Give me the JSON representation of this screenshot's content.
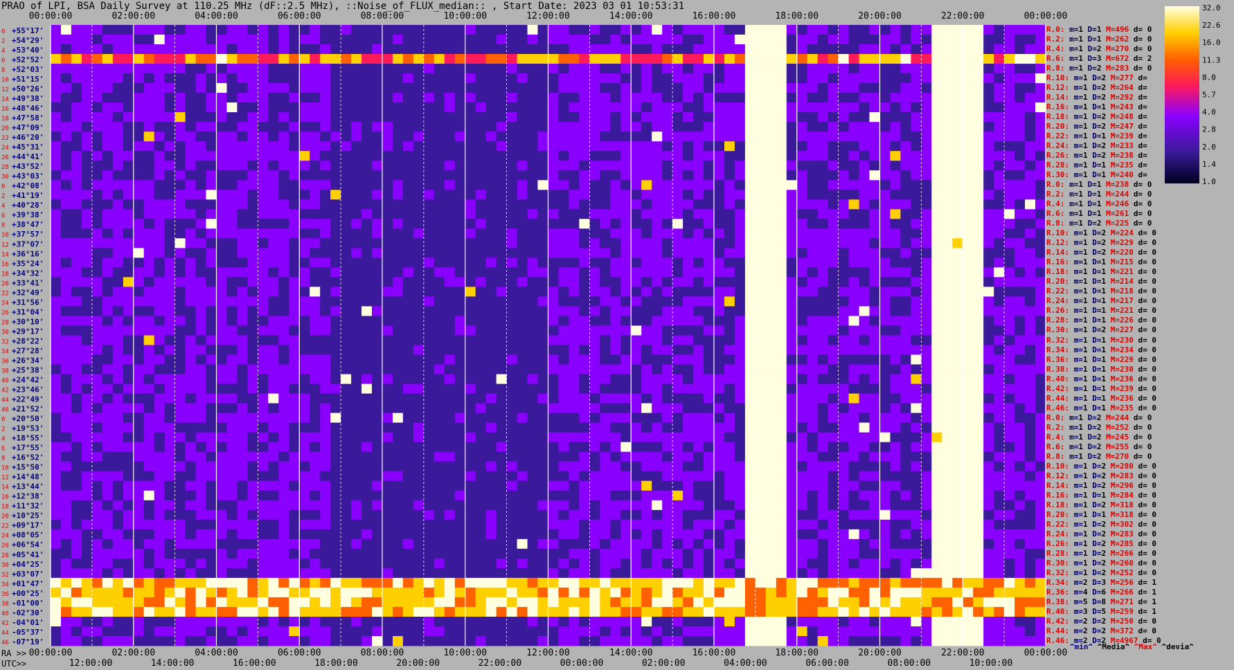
{
  "title": "PRAO of LPI, BSA Daily Survey at 110.25 MHz (dF::2.5 MHz), ::Noise_of_FLUX_median:: , Start Date: 2023 03 01 10:53:31",
  "colors": {
    "background": "#b4b4b4",
    "lowest": "#00001e",
    "low": "#3a1a9a",
    "mid": "#8a00ff",
    "high": "#ff1a00",
    "peak": "#ffff60",
    "saturated": "#ffffff"
  },
  "chart_data": {
    "type": "heatmap",
    "title": "PRAO of LPI, BSA Daily Survey at 110.25 MHz (dF::2.5 MHz), ::Noise_of_FLUX_median:: , Start Date: 2023 03 01 10:53:31",
    "top_axis_ticks": [
      "00:00:00",
      "02:00:00",
      "04:00:00",
      "06:00:00",
      "08:00:00",
      "10:00:00",
      "12:00:00",
      "14:00:00",
      "16:00:00",
      "18:00:00",
      "20:00:00",
      "22:00:00",
      "00:00:00"
    ],
    "ra_axis_label": "RA >>",
    "ra_axis_ticks": [
      "00:00:00",
      "02:00:00",
      "04:00:00",
      "06:00:00",
      "08:00:00",
      "10:00:00",
      "12:00:00",
      "14:00:00",
      "16:00:00",
      "18:00:00",
      "20:00:00",
      "22:00:00",
      "00:00:00"
    ],
    "utc_axis_label": "UTC>>",
    "utc_axis_ticks": [
      "12:00:00",
      "14:00:00",
      "16:00:00",
      "18:00:00",
      "20:00:00",
      "22:00:00",
      "00:00:00",
      "02:00:00",
      "04:00:00",
      "06:00:00",
      "08:00:00",
      "10:00:00"
    ],
    "colorbar": {
      "ticks": [
        "32.0",
        "22.6",
        "16.0",
        "11.3",
        "8.0",
        "5.7",
        "4.0",
        "2.8",
        "2.0",
        "1.4",
        "1.0"
      ],
      "range": [
        1.0,
        32.0
      ],
      "scale": "log"
    },
    "rows": [
      {
        "idx": "0",
        "dec": "+55°17'",
        "label": "R.0:",
        "m": "1",
        "D": "1",
        "M": "496",
        "d": "0"
      },
      {
        "idx": "2",
        "dec": "+54°29'",
        "label": "R.2:",
        "m": "1",
        "D": "1",
        "M": "262",
        "d": "0"
      },
      {
        "idx": "4",
        "dec": "+53°40'",
        "label": "R.4:",
        "m": "1",
        "D": "2",
        "M": "270",
        "d": "0"
      },
      {
        "idx": "6",
        "dec": "+52°52'",
        "label": "R.6:",
        "m": "1",
        "D": "3",
        "M": "672",
        "d": "2"
      },
      {
        "idx": "8",
        "dec": "+52°03'",
        "label": "R.8:",
        "m": "1",
        "D": "2",
        "M": "283",
        "d": "0"
      },
      {
        "idx": "10",
        "dec": "+51°15'",
        "label": "R.10:",
        "m": "1",
        "D": "2",
        "M": "277",
        "d": ""
      },
      {
        "idx": "12",
        "dec": "+50°26'",
        "label": "R.12:",
        "m": "1",
        "D": "2",
        "M": "264",
        "d": ""
      },
      {
        "idx": "14",
        "dec": "+49°38'",
        "label": "R.14:",
        "m": "1",
        "D": "2",
        "M": "292",
        "d": ""
      },
      {
        "idx": "16",
        "dec": "+48°46'",
        "label": "R.16:",
        "m": "1",
        "D": "1",
        "M": "243",
        "d": ""
      },
      {
        "idx": "18",
        "dec": "+47°58'",
        "label": "R.18:",
        "m": "1",
        "D": "2",
        "M": "248",
        "d": ""
      },
      {
        "idx": "20",
        "dec": "+47°09'",
        "label": "R.20:",
        "m": "1",
        "D": "2",
        "M": "247",
        "d": ""
      },
      {
        "idx": "22",
        "dec": "+46°20'",
        "label": "R.22:",
        "m": "1",
        "D": "1",
        "M": "239",
        "d": ""
      },
      {
        "idx": "24",
        "dec": "+45°31'",
        "label": "R.24:",
        "m": "1",
        "D": "2",
        "M": "233",
        "d": ""
      },
      {
        "idx": "26",
        "dec": "+44°41'",
        "label": "R.26:",
        "m": "1",
        "D": "2",
        "M": "238",
        "d": ""
      },
      {
        "idx": "28",
        "dec": "+43°52'",
        "label": "R.28:",
        "m": "1",
        "D": "1",
        "M": "235",
        "d": ""
      },
      {
        "idx": "30",
        "dec": "+43°03'",
        "label": "R.30:",
        "m": "1",
        "D": "1",
        "M": "240",
        "d": ""
      },
      {
        "idx": "0",
        "dec": "+42°08'",
        "label": "R.0:",
        "m": "1",
        "D": "1",
        "M": "238",
        "d": "0"
      },
      {
        "idx": "2",
        "dec": "+41°19'",
        "label": "R.2:",
        "m": "1",
        "D": "1",
        "M": "244",
        "d": "0"
      },
      {
        "idx": "4",
        "dec": "+40°28'",
        "label": "R.4:",
        "m": "1",
        "D": "1",
        "M": "246",
        "d": "0"
      },
      {
        "idx": "6",
        "dec": "+39°38'",
        "label": "R.6:",
        "m": "1",
        "D": "1",
        "M": "261",
        "d": "0"
      },
      {
        "idx": "8",
        "dec": "+38°47'",
        "label": "R.8:",
        "m": "1",
        "D": "2",
        "M": "225",
        "d": "0"
      },
      {
        "idx": "10",
        "dec": "+37°57'",
        "label": "R.10:",
        "m": "1",
        "D": "2",
        "M": "224",
        "d": "0"
      },
      {
        "idx": "12",
        "dec": "+37°07'",
        "label": "R.12:",
        "m": "1",
        "D": "2",
        "M": "229",
        "d": "0"
      },
      {
        "idx": "14",
        "dec": "+36°16'",
        "label": "R.14:",
        "m": "1",
        "D": "2",
        "M": "220",
        "d": "0"
      },
      {
        "idx": "16",
        "dec": "+35°24'",
        "label": "R.16:",
        "m": "1",
        "D": "1",
        "M": "215",
        "d": "0"
      },
      {
        "idx": "18",
        "dec": "+34°32'",
        "label": "R.18:",
        "m": "1",
        "D": "1",
        "M": "221",
        "d": "0"
      },
      {
        "idx": "20",
        "dec": "+33°41'",
        "label": "R.20:",
        "m": "1",
        "D": "1",
        "M": "214",
        "d": "0"
      },
      {
        "idx": "22",
        "dec": "+32°49'",
        "label": "R.22:",
        "m": "1",
        "D": "1",
        "M": "218",
        "d": "0"
      },
      {
        "idx": "24",
        "dec": "+31°56'",
        "label": "R.24:",
        "m": "1",
        "D": "1",
        "M": "217",
        "d": "0"
      },
      {
        "idx": "26",
        "dec": "+31°04'",
        "label": "R.26:",
        "m": "1",
        "D": "1",
        "M": "221",
        "d": "0"
      },
      {
        "idx": "28",
        "dec": "+30°10'",
        "label": "R.28:",
        "m": "1",
        "D": "1",
        "M": "226",
        "d": "0"
      },
      {
        "idx": "30",
        "dec": "+29°17'",
        "label": "R.30:",
        "m": "1",
        "D": "2",
        "M": "227",
        "d": "0"
      },
      {
        "idx": "32",
        "dec": "+28°22'",
        "label": "R.32:",
        "m": "1",
        "D": "1",
        "M": "230",
        "d": "0"
      },
      {
        "idx": "34",
        "dec": "+27°28'",
        "label": "R.34:",
        "m": "1",
        "D": "1",
        "M": "234",
        "d": "0"
      },
      {
        "idx": "36",
        "dec": "+26°34'",
        "label": "R.36:",
        "m": "1",
        "D": "1",
        "M": "229",
        "d": "0"
      },
      {
        "idx": "38",
        "dec": "+25°38'",
        "label": "R.38:",
        "m": "1",
        "D": "1",
        "M": "230",
        "d": "0"
      },
      {
        "idx": "40",
        "dec": "+24°42'",
        "label": "R.40:",
        "m": "1",
        "D": "1",
        "M": "236",
        "d": "0"
      },
      {
        "idx": "42",
        "dec": "+23°46'",
        "label": "R.42:",
        "m": "1",
        "D": "1",
        "M": "239",
        "d": "0"
      },
      {
        "idx": "44",
        "dec": "+22°49'",
        "label": "R.44:",
        "m": "1",
        "D": "1",
        "M": "236",
        "d": "0"
      },
      {
        "idx": "46",
        "dec": "+21°52'",
        "label": "R.46:",
        "m": "1",
        "D": "1",
        "M": "235",
        "d": "0"
      },
      {
        "idx": "0",
        "dec": "+20°50'",
        "label": "R.0:",
        "m": "1",
        "D": "2",
        "M": "244",
        "d": "0"
      },
      {
        "idx": "2",
        "dec": "+19°53'",
        "label": "R.2:",
        "m": "1",
        "D": "2",
        "M": "252",
        "d": "0"
      },
      {
        "idx": "4",
        "dec": "+18°55'",
        "label": "R.4:",
        "m": "1",
        "D": "2",
        "M": "245",
        "d": "0"
      },
      {
        "idx": "6",
        "dec": "+17°55'",
        "label": "R.6:",
        "m": "1",
        "D": "2",
        "M": "255",
        "d": "0"
      },
      {
        "idx": "8",
        "dec": "+16°52'",
        "label": "R.8:",
        "m": "1",
        "D": "2",
        "M": "270",
        "d": "0"
      },
      {
        "idx": "10",
        "dec": "+15°50'",
        "label": "R.10:",
        "m": "1",
        "D": "2",
        "M": "280",
        "d": "0"
      },
      {
        "idx": "12",
        "dec": "+14°48'",
        "label": "R.12:",
        "m": "1",
        "D": "2",
        "M": "283",
        "d": "0"
      },
      {
        "idx": "14",
        "dec": "+13°44'",
        "label": "R.14:",
        "m": "1",
        "D": "2",
        "M": "296",
        "d": "0"
      },
      {
        "idx": "16",
        "dec": "+12°38'",
        "label": "R.16:",
        "m": "1",
        "D": "1",
        "M": "284",
        "d": "0"
      },
      {
        "idx": "18",
        "dec": "+11°32'",
        "label": "R.18:",
        "m": "1",
        "D": "2",
        "M": "318",
        "d": "0"
      },
      {
        "idx": "20",
        "dec": "+10°25'",
        "label": "R.20:",
        "m": "1",
        "D": "1",
        "M": "318",
        "d": "0"
      },
      {
        "idx": "22",
        "dec": "+09°17'",
        "label": "R.22:",
        "m": "1",
        "D": "2",
        "M": "302",
        "d": "0"
      },
      {
        "idx": "24",
        "dec": "+08°05'",
        "label": "R.24:",
        "m": "1",
        "D": "2",
        "M": "283",
        "d": "0"
      },
      {
        "idx": "26",
        "dec": "+06°54'",
        "label": "R.26:",
        "m": "1",
        "D": "2",
        "M": "285",
        "d": "0"
      },
      {
        "idx": "28",
        "dec": "+05°41'",
        "label": "R.28:",
        "m": "1",
        "D": "2",
        "M": "266",
        "d": "0"
      },
      {
        "idx": "30",
        "dec": "+04°25'",
        "label": "R.30:",
        "m": "1",
        "D": "2",
        "M": "260",
        "d": "0"
      },
      {
        "idx": "32",
        "dec": "+03°07'",
        "label": "R.32:",
        "m": "1",
        "D": "2",
        "M": "252",
        "d": "0"
      },
      {
        "idx": "34",
        "dec": "+01°47'",
        "label": "R.34:",
        "m": "2",
        "D": "3",
        "M": "256",
        "d": "1"
      },
      {
        "idx": "36",
        "dec": "+00°25'",
        "label": "R.36:",
        "m": "4",
        "D": "6",
        "M": "266",
        "d": "1"
      },
      {
        "idx": "38",
        "dec": "-01°00'",
        "label": "R.38:",
        "m": "5",
        "D": "8",
        "M": "271",
        "d": "1"
      },
      {
        "idx": "40",
        "dec": "-02°30'",
        "label": "R.40:",
        "m": "3",
        "D": "5",
        "M": "259",
        "d": "1"
      },
      {
        "idx": "42",
        "dec": "-04°01'",
        "label": "R.42:",
        "m": "2",
        "D": "2",
        "M": "250",
        "d": "0"
      },
      {
        "idx": "44",
        "dec": "-05°37'",
        "label": "R.44:",
        "m": "2",
        "D": "2",
        "M": "372",
        "d": "0"
      },
      {
        "idx": "46",
        "dec": "-07°19'",
        "label": "R.46:",
        "m": "2",
        "D": "2",
        "M": "4967",
        "d": "0"
      }
    ],
    "legend": [
      {
        "text": "^min^",
        "color": "#000080"
      },
      {
        "text": "^Media^",
        "color": "#000000"
      },
      {
        "text": "^Max^",
        "color": "#e00000"
      },
      {
        "text": "^devia^",
        "color": "#000000"
      }
    ]
  }
}
